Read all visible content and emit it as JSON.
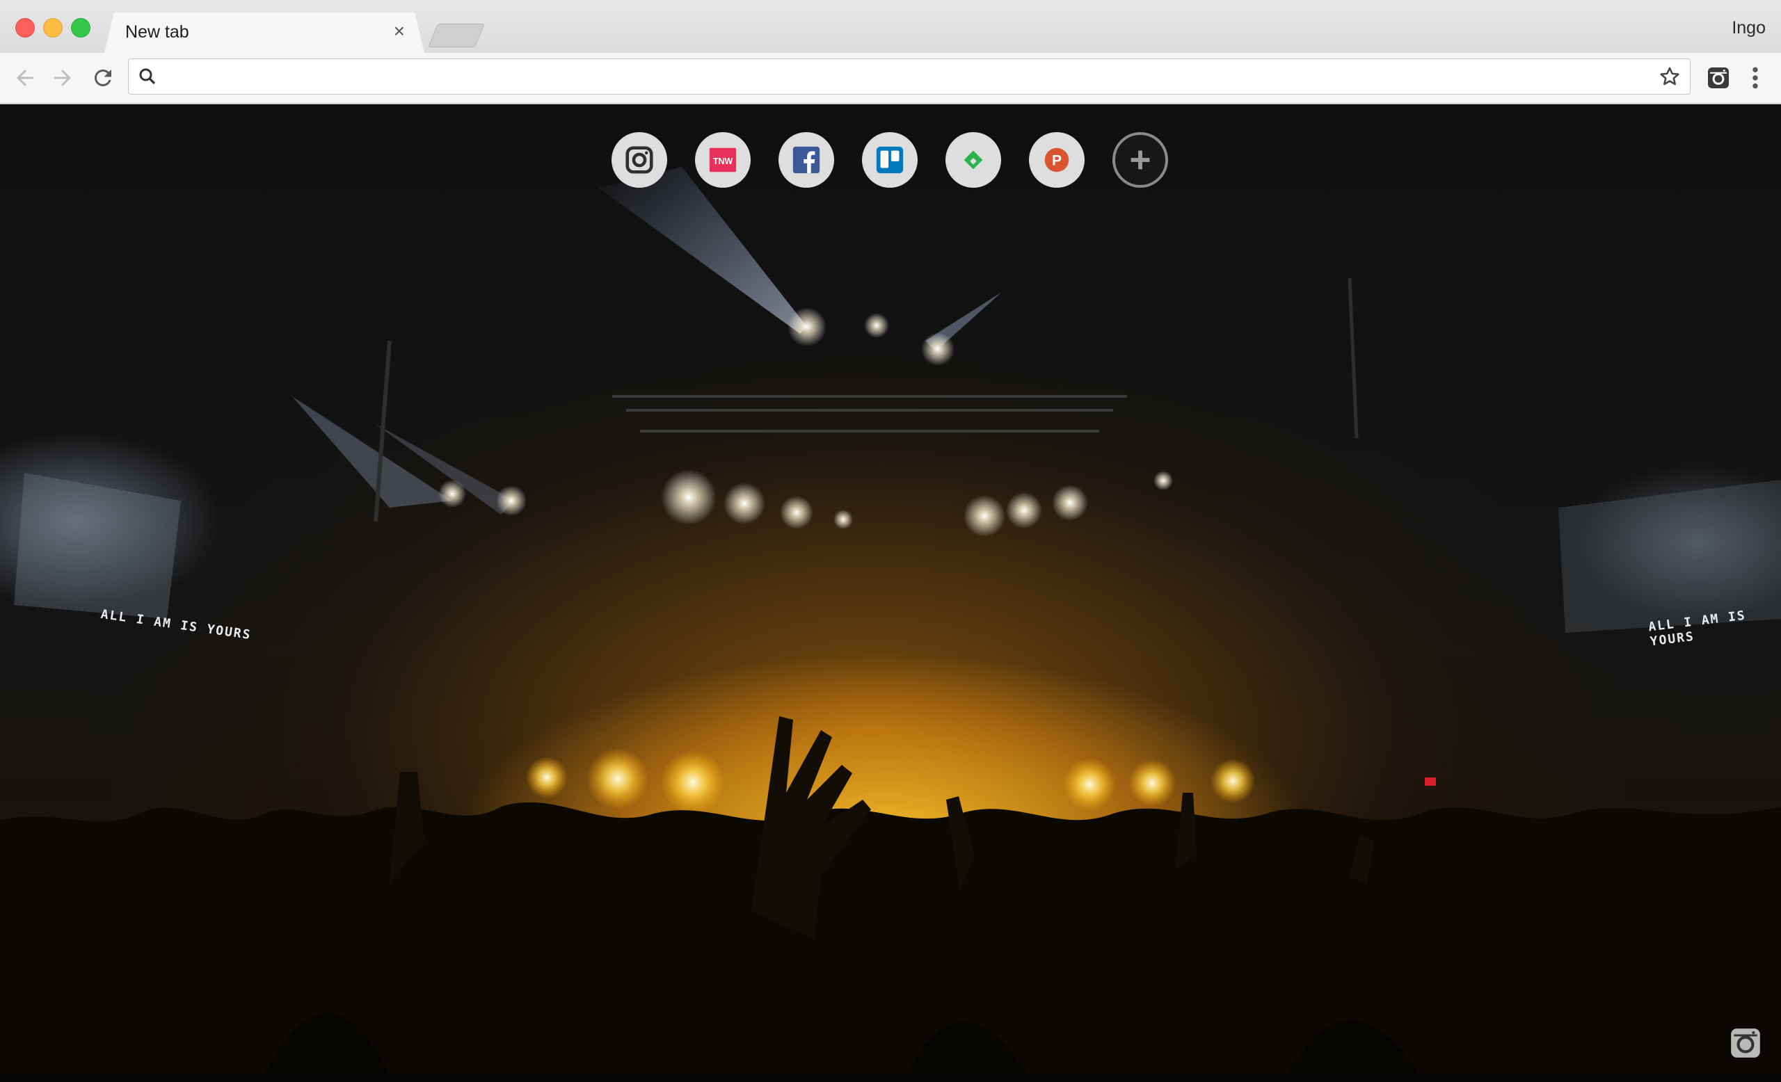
{
  "window": {
    "tab_title": "New tab",
    "tab_close_glyph": "×",
    "profile_name": "Ingo"
  },
  "toolbar": {
    "back_icon": "back-arrow-icon",
    "forward_icon": "forward-arrow-icon",
    "reload_icon": "reload-icon",
    "omnibox_value": "",
    "omnibox_placeholder": "",
    "bookmark_icon": "star-icon",
    "extension_icon": "instagram-icon",
    "menu_icon": "vertical-dots-icon"
  },
  "shortcuts": [
    {
      "name": "Instagram",
      "icon": "instagram-icon"
    },
    {
      "name": "TNW",
      "icon": "tnw-icon",
      "text": "TNW",
      "color": "#e8305a"
    },
    {
      "name": "Facebook",
      "icon": "facebook-icon",
      "text": "f",
      "color": "#3b5998"
    },
    {
      "name": "Trello",
      "icon": "trello-icon",
      "color": "#0079bf"
    },
    {
      "name": "Feedly",
      "icon": "feedly-icon",
      "color": "#2bb24c"
    },
    {
      "name": "Product Hunt",
      "icon": "product-hunt-icon",
      "text": "P",
      "color": "#da552f"
    },
    {
      "name": "Add shortcut",
      "icon": "add-icon",
      "text": "+"
    }
  ],
  "background": {
    "screen_text_left": "ALL I AM IS YOURS",
    "screen_text_right": "ALL I AM IS YOURS",
    "corner_icon": "camera-icon"
  }
}
